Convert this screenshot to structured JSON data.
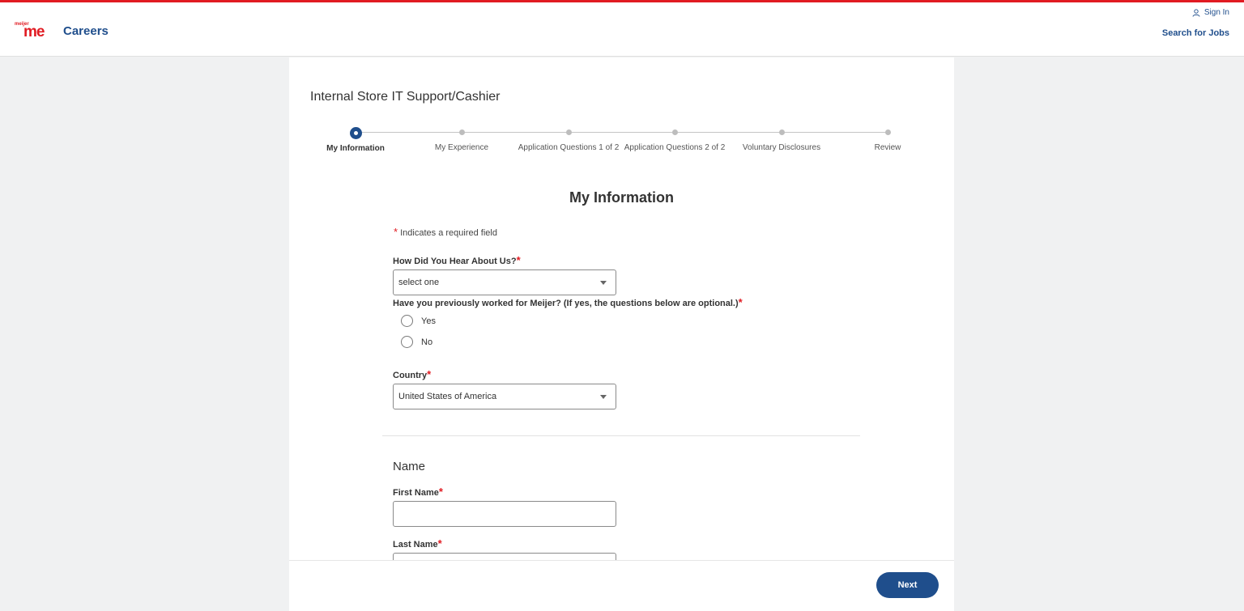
{
  "header": {
    "logo_small": "meijer",
    "logo_big": "me",
    "careers_label": "Careers",
    "sign_in_label": "Sign In",
    "search_jobs_label": "Search for Jobs"
  },
  "job": {
    "title": "Internal Store IT Support/Cashier"
  },
  "stepper": {
    "steps": [
      {
        "label": "My Information",
        "active": true
      },
      {
        "label": "My Experience"
      },
      {
        "label": "Application Questions 1 of 2"
      },
      {
        "label": "Application Questions 2 of 2"
      },
      {
        "label": "Voluntary Disclosures"
      },
      {
        "label": "Review"
      }
    ]
  },
  "form": {
    "section_title": "My Information",
    "required_asterisk": "*",
    "required_note": "Indicates a required field",
    "hear_about_label": "How Did You Hear About Us?",
    "hear_about_value": "select one",
    "previous_meijer_label": "Have you previously worked for Meijer? (If yes, the questions below are optional.)",
    "radio_yes": "Yes",
    "radio_no": "No",
    "country_label": "Country",
    "country_value": "United States of America",
    "name_heading": "Name",
    "first_name_label": "First Name",
    "last_name_label": "Last Name"
  },
  "footer": {
    "next_label": "Next"
  },
  "colors": {
    "brand_red": "#e11b22",
    "brand_blue": "#1f4e8c"
  },
  "icons": {
    "sign_in": "user-icon",
    "select": "caret-down-icon"
  }
}
